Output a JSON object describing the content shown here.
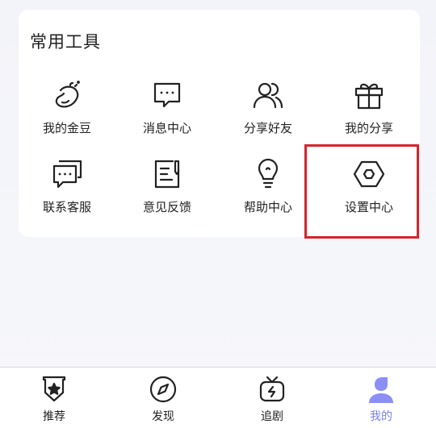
{
  "tools_card": {
    "title": "常用工具",
    "items": [
      {
        "label": "我的金豆",
        "icon": "bean-icon"
      },
      {
        "label": "消息中心",
        "icon": "message-icon"
      },
      {
        "label": "分享好友",
        "icon": "users-icon"
      },
      {
        "label": "我的分享",
        "icon": "gift-icon"
      },
      {
        "label": "联系客服",
        "icon": "chat-icon"
      },
      {
        "label": "意见反馈",
        "icon": "feedback-icon"
      },
      {
        "label": "帮助中心",
        "icon": "lightbulb-icon"
      },
      {
        "label": "设置中心",
        "icon": "settings-hexagon-icon"
      }
    ]
  },
  "tabbar": {
    "items": [
      {
        "label": "推荐",
        "icon": "star-badge-icon",
        "active": false
      },
      {
        "label": "发现",
        "icon": "compass-icon",
        "active": false
      },
      {
        "label": "追剧",
        "icon": "tv-icon",
        "active": false
      },
      {
        "label": "我的",
        "icon": "user-icon",
        "active": true
      }
    ]
  },
  "colors": {
    "accent": "#7b7ff0",
    "highlight_border": "#d8232a",
    "background": "#f3f4f9",
    "card": "#ffffff"
  }
}
